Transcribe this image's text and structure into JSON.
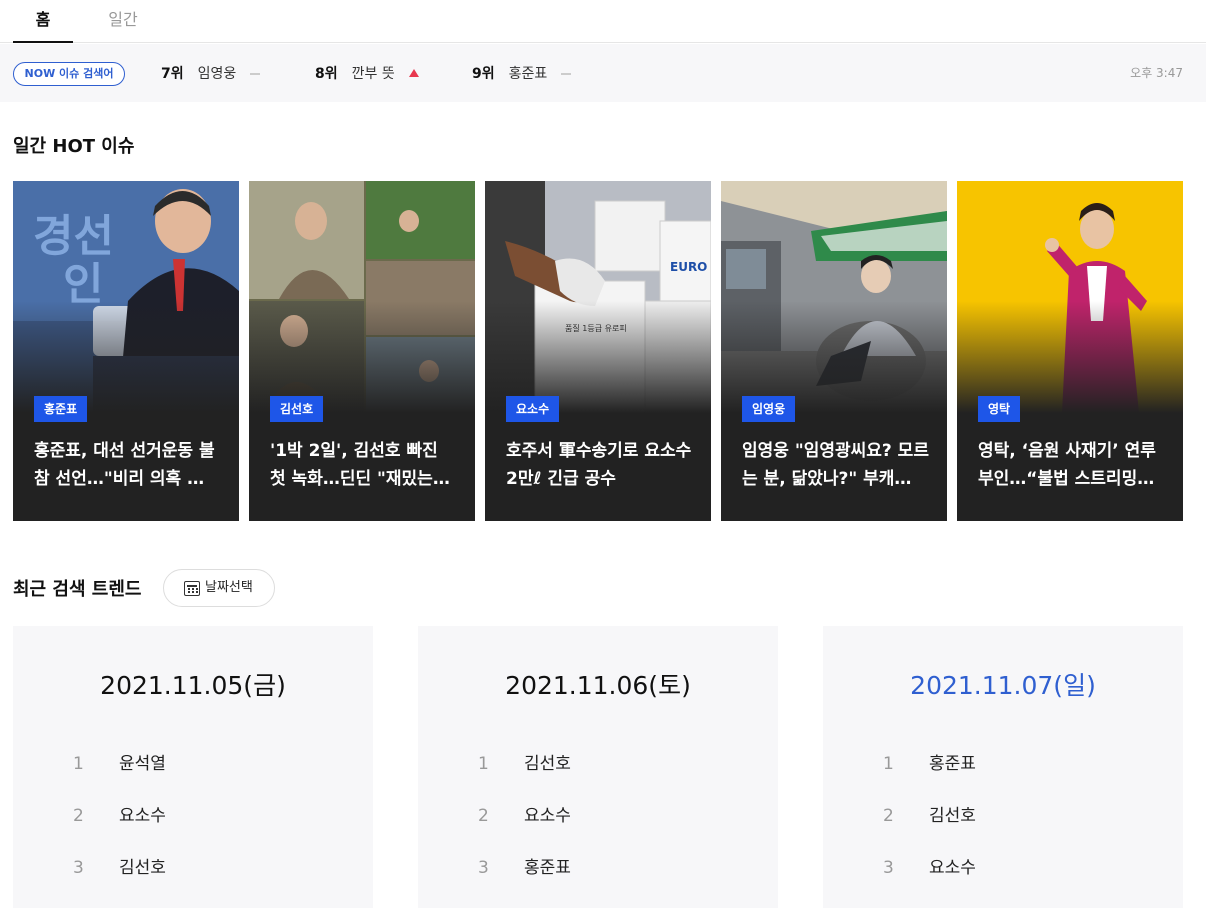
{
  "tabs": [
    {
      "label": "홈",
      "active": true
    },
    {
      "label": "일간",
      "active": false
    }
  ],
  "now_bar": {
    "pill_label": "NOW 이슈 검색어",
    "items": [
      {
        "rank": "7위",
        "keyword": "임영웅",
        "trend": "flat"
      },
      {
        "rank": "8위",
        "keyword": "깐부 뜻",
        "trend": "up"
      },
      {
        "rank": "9위",
        "keyword": "홍준표",
        "trend": "flat"
      }
    ],
    "time": "오후 3:47",
    "colors": {
      "accent": "#2f5fd0",
      "up": "#e8384f"
    }
  },
  "hot": {
    "title": "일간 HOT 이슈",
    "cards": [
      {
        "tag": "홍준표",
        "headline": "홍준표, 대선 선거운동 불참 선언…\"비리 의혹 …",
        "image_desc": "speaker-at-podium"
      },
      {
        "tag": "김선호",
        "headline": "'1박 2일', 김선호 빠진 첫 녹화…딘딘 \"재밌는데…",
        "image_desc": "tv-show-collage"
      },
      {
        "tag": "요소수",
        "headline": "호주서 軍수송기로 요소수 2만ℓ 긴급 공수",
        "image_desc": "boxes-being-carried"
      },
      {
        "tag": "임영웅",
        "headline": "임영웅 \"임영광씨요? 모르는 분, 닮았나?\" 부캐…",
        "image_desc": "man-in-chair"
      },
      {
        "tag": "영탁",
        "headline": "영탁, ‘음원 사재기’ 연루 부인…“불법 스트리밍…",
        "image_desc": "singer-pink-suit"
      }
    ],
    "tag_color": "#1e56e8"
  },
  "trends": {
    "title": "최근 검색 트렌드",
    "date_button": "날짜선택",
    "columns": [
      {
        "date": "2021.11.05(금)",
        "highlight": false,
        "items": [
          {
            "n": "1",
            "kw": "윤석열"
          },
          {
            "n": "2",
            "kw": "요소수"
          },
          {
            "n": "3",
            "kw": "김선호"
          }
        ]
      },
      {
        "date": "2021.11.06(토)",
        "highlight": false,
        "items": [
          {
            "n": "1",
            "kw": "김선호"
          },
          {
            "n": "2",
            "kw": "요소수"
          },
          {
            "n": "3",
            "kw": "홍준표"
          }
        ]
      },
      {
        "date": "2021.11.07(일)",
        "highlight": true,
        "items": [
          {
            "n": "1",
            "kw": "홍준표"
          },
          {
            "n": "2",
            "kw": "김선호"
          },
          {
            "n": "3",
            "kw": "요소수"
          }
        ]
      }
    ]
  }
}
